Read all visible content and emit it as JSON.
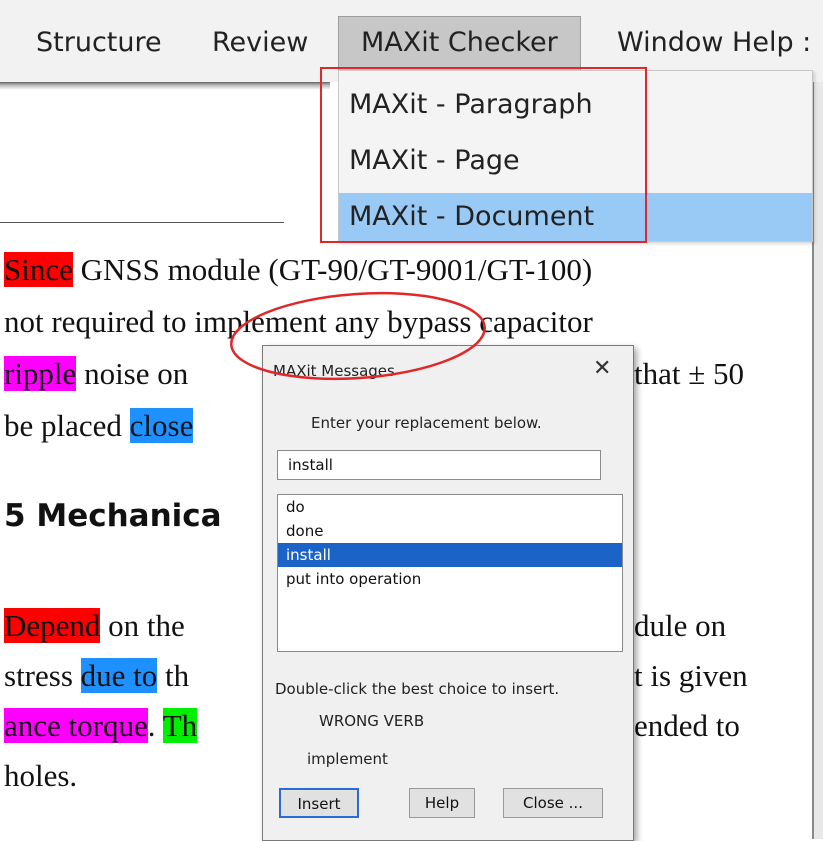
{
  "menubar": {
    "items": [
      "Structure",
      "Review",
      "MAXit Checker",
      "Window Help :"
    ]
  },
  "dropdown": {
    "items": [
      "MAXit - Paragraph",
      "MAXit - Page",
      "MAXit - Document"
    ],
    "highlighted_index": 2
  },
  "document": {
    "lines": [
      {
        "hl": "Since",
        "rest": " GNSS module (GT-90/GT-9001/GT-100)"
      },
      {
        "text": "not required to implement any bypass capacitor"
      },
      {
        "hl": "ripple",
        "rest": " noise on",
        "tail": "that ± 50"
      },
      {
        "pre": "be placed ",
        "hl": "close"
      },
      {
        "heading": "5  Mechanica"
      },
      {
        "hl": "Depend",
        "rest": " on the",
        "tail": "dule on"
      },
      {
        "pre": "stress ",
        "hl": "due to",
        "rest": " th",
        "tail": "t is given"
      },
      {
        "hl": "ance torque",
        "rest": ". ",
        "hl2": "Th",
        "tail": "ended to"
      },
      {
        "text": "holes."
      }
    ]
  },
  "dialog": {
    "title": "MAXit Messages",
    "close_glyph": "✕",
    "prompt": "Enter your replacement below.",
    "input_value": "install",
    "suggestions": [
      "do",
      "done",
      "install",
      "put into operation"
    ],
    "selected_suggestion": "install",
    "hint": "Double-click the best choice to insert.",
    "error_type": "WRONG VERB",
    "original_word": "implement",
    "buttons": {
      "insert": "Insert",
      "help": "Help",
      "close": "Close ..."
    }
  },
  "colors": {
    "highlight_red": "#ff0000",
    "highlight_magenta": "#ff00ff",
    "highlight_blue": "#1e90ff",
    "highlight_green": "#00ee00",
    "menu_highlight": "#99c9f5",
    "annotation_red": "#e0282a"
  }
}
